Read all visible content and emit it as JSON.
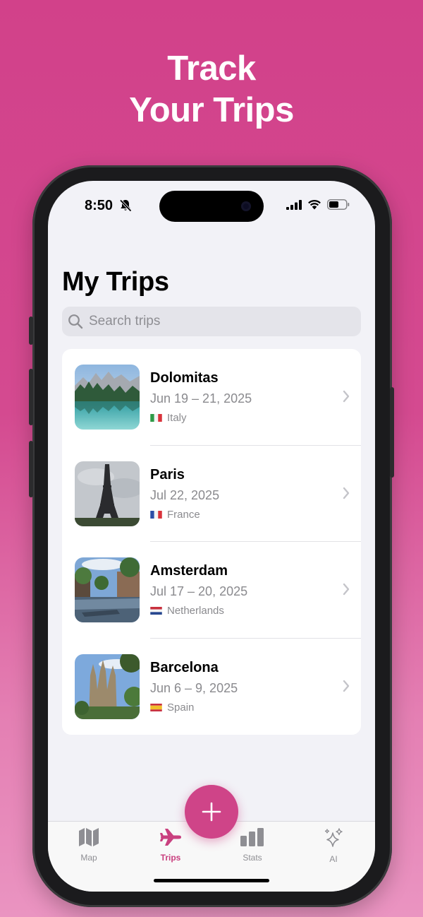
{
  "promo": {
    "line1": "Track",
    "line2": "Your Trips"
  },
  "status_bar": {
    "time": "8:50"
  },
  "page": {
    "title": "My Trips"
  },
  "search": {
    "placeholder": "Search trips"
  },
  "trips": [
    {
      "name": "Dolomitas",
      "dates": "Jun 19 – 21, 2025",
      "country": "Italy"
    },
    {
      "name": "Paris",
      "dates": "Jul 22, 2025",
      "country": "France"
    },
    {
      "name": "Amsterdam",
      "dates": "Jul 17 – 20, 2025",
      "country": "Netherlands"
    },
    {
      "name": "Barcelona",
      "dates": "Jun 6 – 9, 2025",
      "country": "Spain"
    }
  ],
  "tabs": [
    {
      "label": "Map",
      "icon": "map-icon"
    },
    {
      "label": "Trips",
      "icon": "airplane-icon",
      "active": true
    },
    {
      "label": "Stats",
      "icon": "chart-icon"
    },
    {
      "label": "AI",
      "icon": "sparkles-icon"
    }
  ],
  "colors": {
    "accent": "#cf4488",
    "background_top": "#d2418a",
    "background_bottom": "#ea94c1",
    "secondary_text": "#8a8a8e"
  }
}
